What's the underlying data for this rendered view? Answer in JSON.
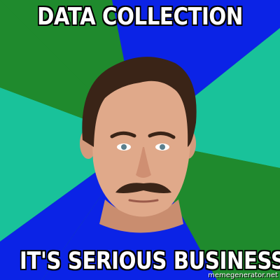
{
  "meme": {
    "top_text": "DATA COLLECTION",
    "bottom_text": "IT'S SERIOUS BUSINESS",
    "watermark": "memegenerator.net"
  },
  "colors": {
    "bg_green": "#1f8a2d",
    "bg_blue": "#0b23e6",
    "bg_teal": "#19c29a",
    "text": "#ffffff",
    "text_outline": "#000000"
  }
}
